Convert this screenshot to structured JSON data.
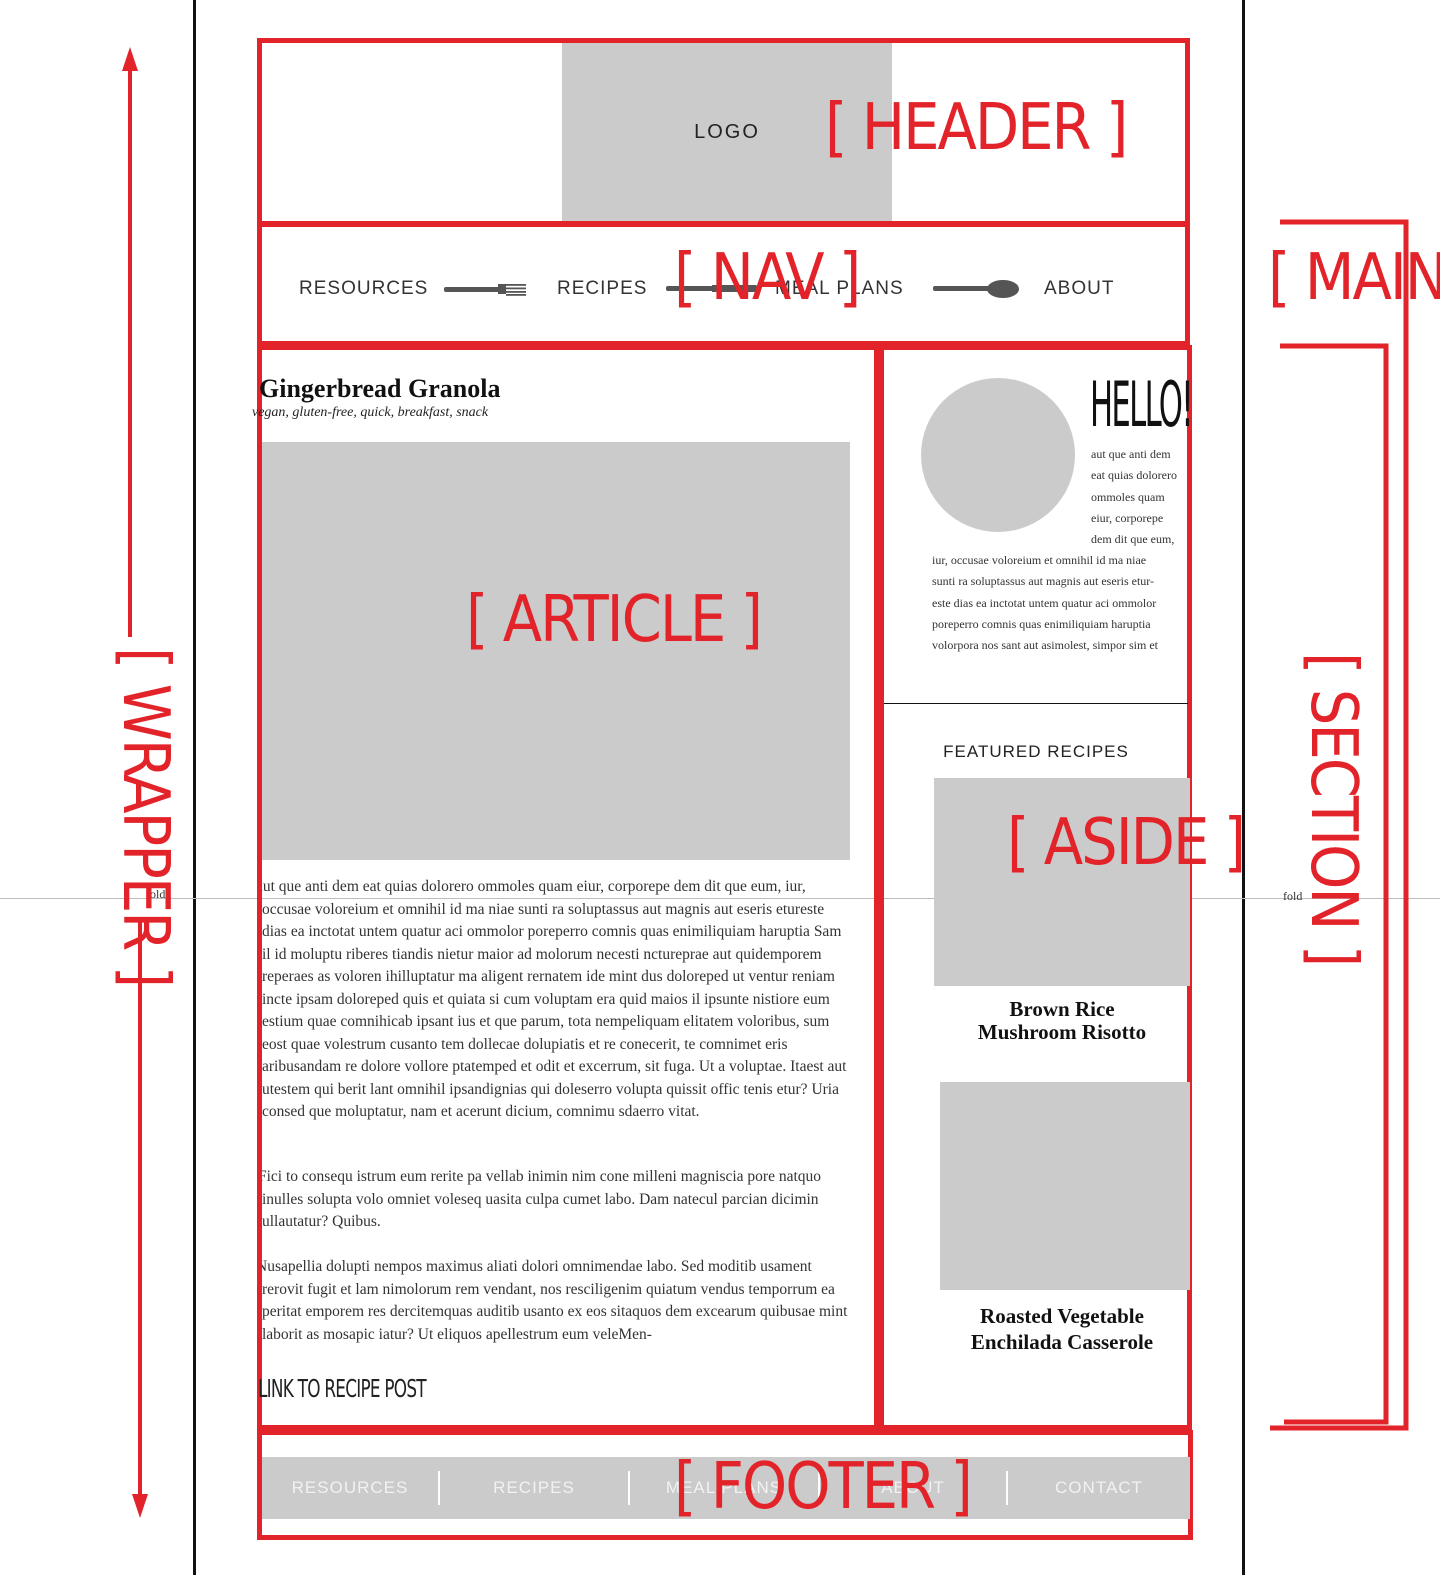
{
  "header": {
    "logo": "LOGO",
    "label": "[ HEADER ]"
  },
  "nav": {
    "label": "[ NAV ]",
    "items": [
      "RESOURCES",
      "RECIPES",
      "MEAL PLANS",
      "ABOUT"
    ]
  },
  "article": {
    "label": "[ ARTICLE ]",
    "title": "Gingerbread Granola",
    "tags": "vegan, gluten-free, quick, breakfast, snack",
    "paragraphs": [
      "aut que anti dem eat quias dolorero ommoles quam eiur, corporepe dem dit que eum, iur, occusae voloreium et omnihil id ma niae sunti ra soluptassus aut magnis aut eseris etureste dias ea inctotat untem quatur aci ommolor poreperro comnis quas enimiliquiam haruptia Sam il id moluptu riberes tiandis nietur maior ad molorum necesti nctureprae aut quidemporem reperaes as voloren ihilluptatur ma aligent rernatem ide mint dus doloreped ut ventur reniam incte ipsam doloreped quis et quiata si cum voluptam era quid maios il ipsunte nistiore eum estium quae comnihicab ipsant ius et que parum, tota nempeliquam elitatem voloribus, sum eost quae volestrum cusanto tem dollecae dolupiatis et re conecerit, te comnimet eris aribusandam re dolore vollore ptatemped et odit et excerrum, sit fuga. Ut a voluptae. Itaest aut utestem qui berit lant omnihil ipsandignias qui doleserro volupta quissit offic tenis etur? Uria consed que moluptatur, nam et acerunt dicium, comnimu sdaerro vitat.",
      "Fici to consequ istrum eum rerite pa vellab inimin nim cone milleni magniscia pore natquo inulles solupta volo omniet voleseq uasita culpa cumet labo. Dam natecul parcian dicimin ullautatur? Quibus.",
      "Nusapellia dolupti nempos maximus aliati dolori omnimendae labo. Sed moditib usament rerovit fugit et lam nimolorum rem vendant, nos resciligenim quiatum vendus temporrum ea peritat emporem res dercitemquas auditib usanto ex eos sitaquos dem excearum quibusae mint laborit as mosapic iatur? Ut eliquos apellestrum eum veleMen-"
    ],
    "link": "LINK TO RECIPE POST"
  },
  "aside": {
    "label": "[ ASIDE ]",
    "hello": "HELLO!",
    "intro_lines": [
      "aut que anti dem",
      "eat quias dolorero",
      "ommoles quam",
      "eiur, corporepe",
      "dem dit que eum,"
    ],
    "intro_wide_lines": [
      "iur, occusae voloreium et omnihil id ma niae",
      "sunti ra soluptassus aut magnis aut eseris etur-",
      "este dias ea inctotat untem quatur aci ommolor",
      "poreperro comnis quas enimiliquiam haruptia",
      "volorpora nos sant aut asimolest, simpor sim et"
    ],
    "featured_heading": "FEATURED RECIPES",
    "recipes": [
      {
        "line1": "Brown Rice",
        "line2": "Mushroom Risotto"
      },
      {
        "line1": "Roasted Vegetable",
        "line2": "Enchilada Casserole"
      }
    ]
  },
  "footer": {
    "label": "[ FOOTER ]",
    "items": [
      "RESOURCES",
      "RECIPES",
      "MEAL PLANS",
      "ABOUT",
      "CONTACT"
    ]
  },
  "labels": {
    "wrapper": "[ WRAPPER ]",
    "main": "[ MAIN ]",
    "section": "[ SECTION ]",
    "fold_left": "fold",
    "fold_right": "fold"
  },
  "colors": {
    "annotation": "#e3232a",
    "placeholder": "#cbcbcb"
  }
}
